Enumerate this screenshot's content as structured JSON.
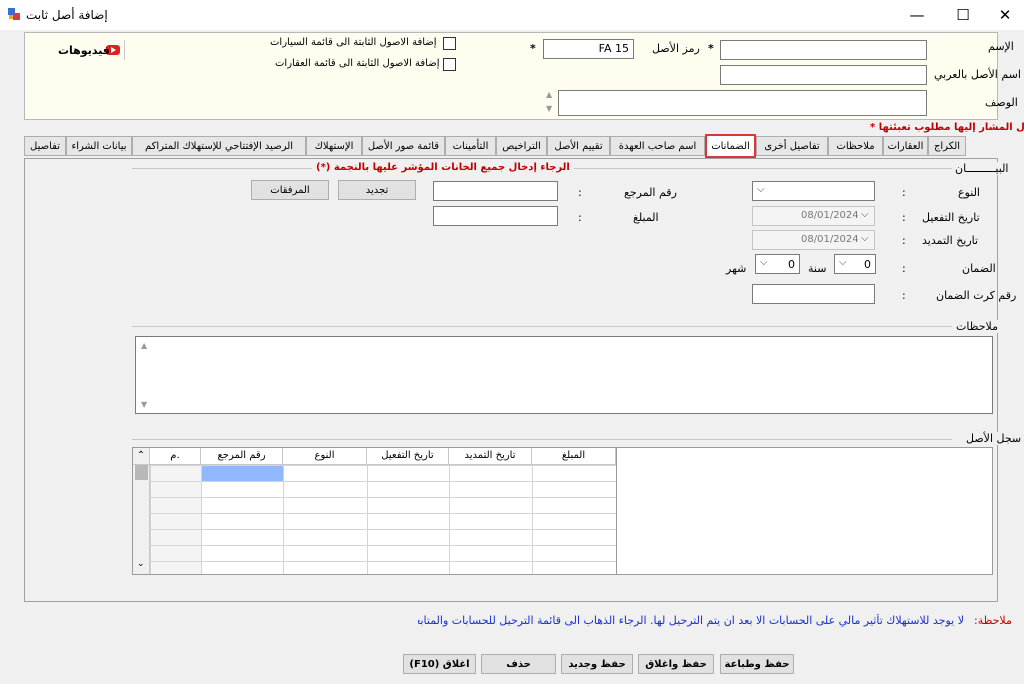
{
  "window": {
    "title": "إضافة أصل ثابت",
    "minimize": "—",
    "maximize": "☐",
    "close": "✕"
  },
  "top": {
    "name_label": "الإسم",
    "arabic_name_label": "اسم الأصل بالعربي",
    "description_label": "الوصف",
    "asset_code_label": "رمز الأصل",
    "asset_code_value": "FA 15",
    "cars_checkbox_label": "إضافة الاصول الثابتة الى قائمة السيارات",
    "realestate_checkbox_label": "إضافة الاصول الثابتة الى قائمة العقارات",
    "videos_label": "فيديوهات",
    "required_star": "*"
  },
  "required_note": "الحقول المشار إليها مطلوب تعبئتها *",
  "tabs": [
    "الكراج",
    "العقارات",
    "ملاحظات",
    "تفاصيل أخرى",
    "الضمانات",
    "اسم صاحب العهدة",
    "تقييم الأصل",
    "التراخيص",
    "التأمينات",
    "قائمة صور الأصل",
    "الإستهلاك",
    "الرصيد الإفتتاحي للإستهلاك المتراكم",
    "بيانات الشراء",
    "تفاصيل"
  ],
  "panel": {
    "group_title": "البيـــــــــان",
    "required_hint": "الرجاء إدخال جميع الخانات المؤشر عليها بالنجمة (*)",
    "type_label": "النوع",
    "activation_date_label": "تاريخ التفعيل",
    "renewal_date_label": "تاريخ التمديد",
    "warranty_label": "الضمان",
    "warranty_card_label": "رقم كرت الضمان",
    "reference_label": "رقم المرجع",
    "amount_label": "المبلغ",
    "renew_button": "تجديد",
    "attachments_button": "المرفقات",
    "activation_date_value": "08/01/2024",
    "renewal_date_value": "08/01/2024",
    "warranty_value_1": "0",
    "year_label": "سنة",
    "warranty_value_2": "0",
    "month_label": "شهر",
    "colon": ":",
    "notes_label": "ملاحظات",
    "history_label": "سجل الأصل",
    "grid_headers": [
      "م.",
      "رقم المرجع",
      "النوع",
      "تاريخ التفعيل",
      "تاريخ التمديد",
      "المبلغ"
    ]
  },
  "bottom_note_label": "ملاحظة:",
  "bottom_note_text": "لا يوجد للاستهلاك تأثير مالي على الحسابات الا بعد ان يتم الترحيل لها. الرجاء الذهاب الى قائمة الترحيل للحسابات والمتابعة.",
  "footer_buttons": [
    "حفظ وطباعة",
    "حفظ واغلاق",
    "حفظ وجديد",
    "حذف",
    "اغلاق (F10)"
  ]
}
